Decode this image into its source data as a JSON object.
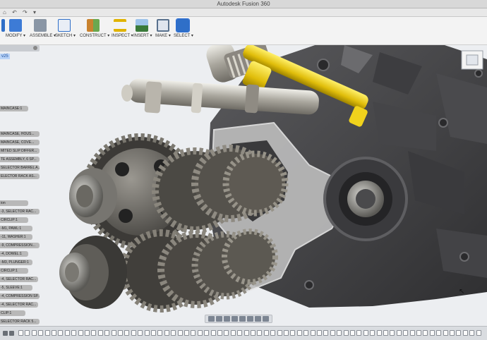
{
  "window": {
    "title": "Autodesk Fusion 360"
  },
  "tabbar": {
    "items": [
      "⌂",
      "↶",
      "↷",
      "▾"
    ]
  },
  "toolbar": {
    "tools": [
      {
        "id": "modify",
        "label": "MODIFY ▾",
        "color": "#3d7bd6"
      },
      {
        "id": "assemble",
        "label": "ASSEMBLE ▾",
        "color": "#7b8a9b"
      },
      {
        "id": "sketch",
        "label": "SKETCH ▾",
        "color": "#2f6fc8"
      },
      {
        "id": "construct",
        "label": "CONSTRUCT ▾",
        "color": "#c9822e"
      },
      {
        "id": "inspect",
        "label": "INSPECT ▾",
        "color": "#e0b300"
      },
      {
        "id": "insert",
        "label": "INSERT ▾",
        "color": "#4a87c6"
      },
      {
        "id": "make",
        "label": "MAKE ▾",
        "color": "#59718d"
      },
      {
        "id": "select",
        "label": "SELECT ▾",
        "color": "#2f6fc8"
      }
    ]
  },
  "browser": {
    "version": "v25",
    "items": [
      "MAINCASE:1",
      "MAINCASE, HOUS...",
      "MAINCASE, COVE...",
      "MITED SLIP DIFFER...",
      "TE ASSEMBLY, 6 SP...",
      "SELECTOR BARREL A...",
      "ELECTOR RACK AS...",
      "ion",
      "-3, SELECTOR RAC...",
      "CIRCLIP:1",
      "-M1, PAWL:1",
      "-11, WASHER:1",
      "-9, COMPRESSION...",
      "-4, DOWEL:1",
      "-M3, PLUNGER:1",
      "CIRCLIP:1",
      "-4, SELECTOR RAC...",
      "-5, SLEEVE:1",
      "-4, COMPRESSION SP...",
      "-4, SELECTOR RAC...",
      "CLIP:1",
      "SELECTOR RACK 5..."
    ]
  },
  "colors": {
    "accent": "#2c6ed5",
    "selected_part": "#e6c80c"
  }
}
